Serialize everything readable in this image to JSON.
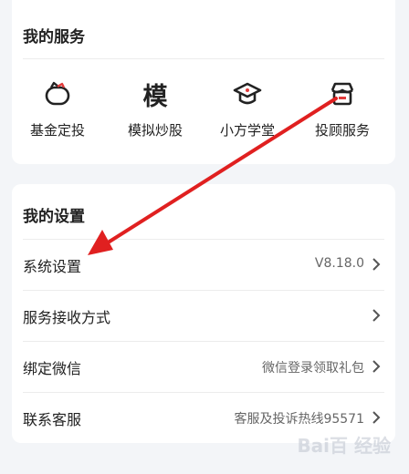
{
  "services": {
    "title": "我的服务",
    "items": [
      {
        "label": "基金定投",
        "icon": "piggy-bank-icon"
      },
      {
        "label": "模拟炒股",
        "icon": "mo-character-icon",
        "glyph": "模"
      },
      {
        "label": "小方学堂",
        "icon": "graduation-cap-icon"
      },
      {
        "label": "投顾服务",
        "icon": "store-icon"
      }
    ]
  },
  "settings": {
    "title": "我的设置",
    "rows": [
      {
        "label": "系统设置",
        "value": "V8.18.0"
      },
      {
        "label": "服务接收方式",
        "value": ""
      },
      {
        "label": "绑定微信",
        "value": "微信登录领取礼包"
      },
      {
        "label": "联系客服",
        "value": "客服及投诉热线95571"
      }
    ]
  },
  "annotation": {
    "arrow_color": "#e02020"
  },
  "watermark": {
    "text": "Bai百 经验"
  }
}
